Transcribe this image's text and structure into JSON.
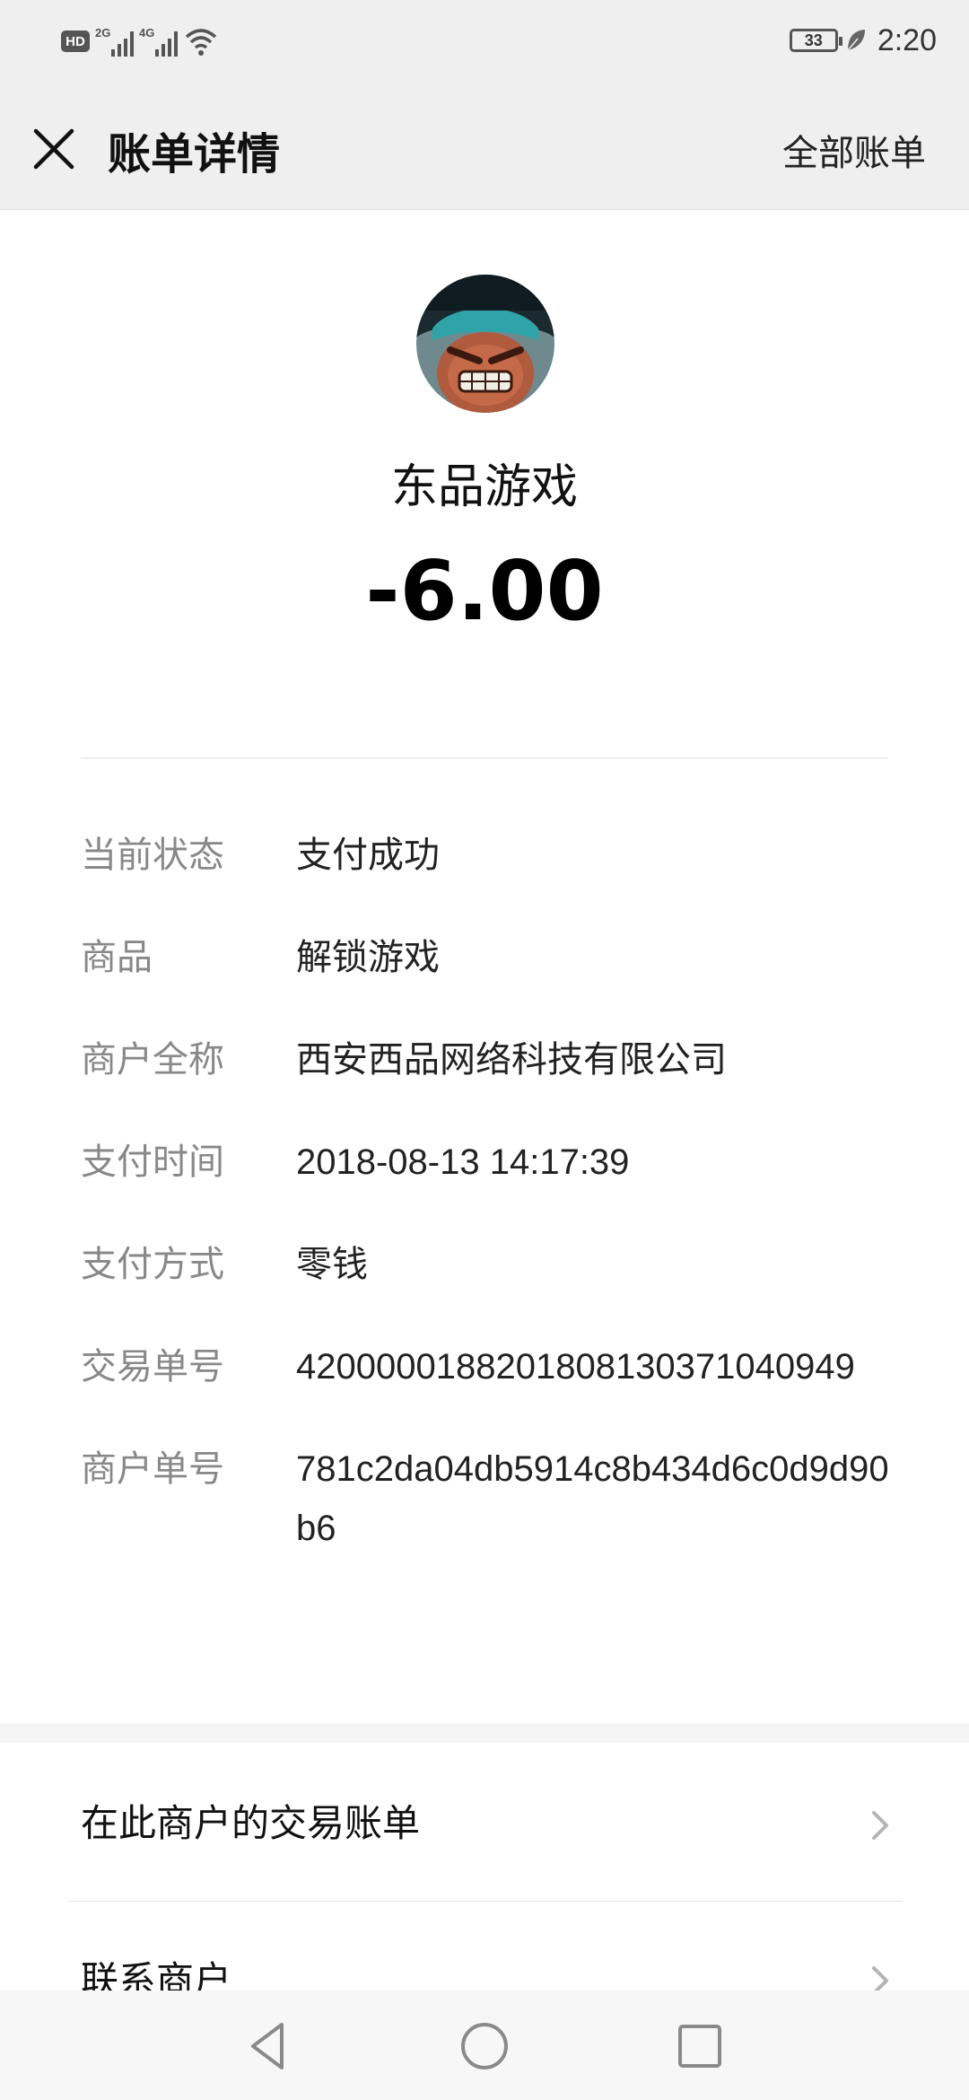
{
  "status_bar": {
    "hd": "HD",
    "sim1_net": "2G",
    "sim2_net": "4G",
    "battery": "33",
    "time": "2:20"
  },
  "header": {
    "title": "账单详情",
    "all_bills": "全部账单"
  },
  "merchant": {
    "name": "东品游戏",
    "amount": "-6.00"
  },
  "details": [
    {
      "label": "当前状态",
      "value": "支付成功"
    },
    {
      "label": "商品",
      "value": "解锁游戏"
    },
    {
      "label": "商户全称",
      "value": "西安西品网络科技有限公司"
    },
    {
      "label": "支付时间",
      "value": "2018-08-13 14:17:39"
    },
    {
      "label": "支付方式",
      "value": "零钱"
    },
    {
      "label": "交易单号",
      "value": "4200000188201808130371040949"
    },
    {
      "label": "商户单号",
      "value": "781c2da04db5914c8b434d6c0d9d90b6"
    }
  ],
  "links": [
    {
      "label": "在此商户的交易账单"
    },
    {
      "label": "联系商户"
    }
  ],
  "colors": {
    "bar_bg": "#efefef",
    "label_gray": "#888888",
    "text": "#111111"
  },
  "icons": {
    "close": "close-icon",
    "chevron": "chevron-right-icon",
    "back": "nav-back-icon",
    "home": "nav-home-icon",
    "recent": "nav-recent-icon"
  }
}
